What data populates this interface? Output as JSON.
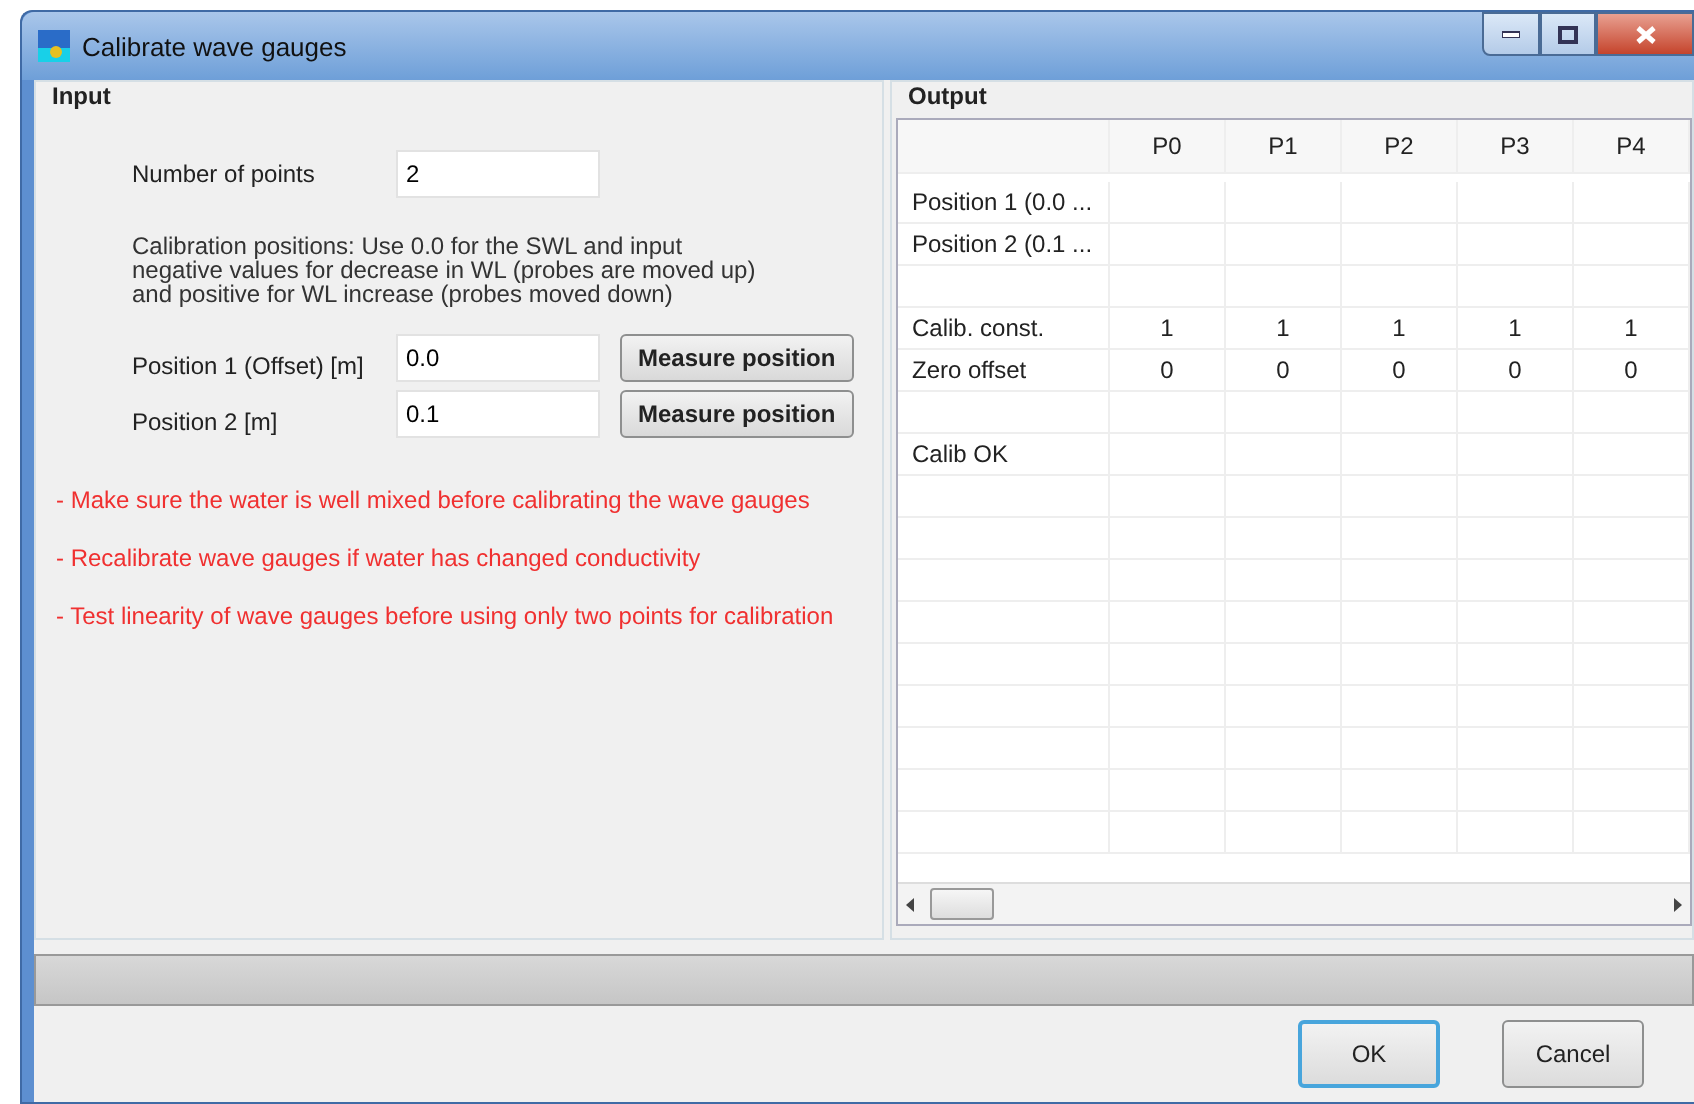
{
  "window": {
    "title": "Calibrate wave gauges"
  },
  "input": {
    "title": "Input",
    "number_of_points": {
      "label": "Number of points",
      "value": "2"
    },
    "note": [
      "Calibration positions: Use 0.0 for the SWL and input",
      "negative values for decrease in WL (probes are moved up)",
      "and positive for WL increase (probes moved down)"
    ],
    "positions": [
      {
        "label": "Position 1 (Offset) [m]",
        "value": "0.0",
        "button": "Measure position"
      },
      {
        "label": "Position 2 [m]",
        "value": "0.1",
        "button": "Measure position"
      }
    ],
    "warnings": [
      "- Make sure the water is well mixed before calibrating the wave gauges",
      "- Recalibrate wave gauges if water has changed conductivity",
      "- Test linearity of wave gauges before using only two points for calibration"
    ]
  },
  "output": {
    "title": "Output",
    "columns": [
      "P0",
      "P1",
      "P2",
      "P3",
      "P4"
    ],
    "rows": [
      {
        "kind": "data",
        "label": "Position 1 (0.0 ..."
      },
      {
        "kind": "data",
        "label": "Position 2 (0.1 ..."
      },
      {
        "kind": "empty"
      },
      {
        "kind": "data",
        "label": "Calib. const.",
        "values": [
          "1",
          "1",
          "1",
          "1",
          "1"
        ]
      },
      {
        "kind": "data",
        "label": "Zero offset",
        "values": [
          "0",
          "0",
          "0",
          "0",
          "0"
        ]
      },
      {
        "kind": "empty"
      },
      {
        "kind": "data",
        "label": "Calib OK"
      }
    ]
  },
  "progress": {
    "level": 0
  },
  "buttons": [
    {
      "label": "OK",
      "selected": true
    },
    {
      "label": "Cancel",
      "selected": false
    }
  ]
}
